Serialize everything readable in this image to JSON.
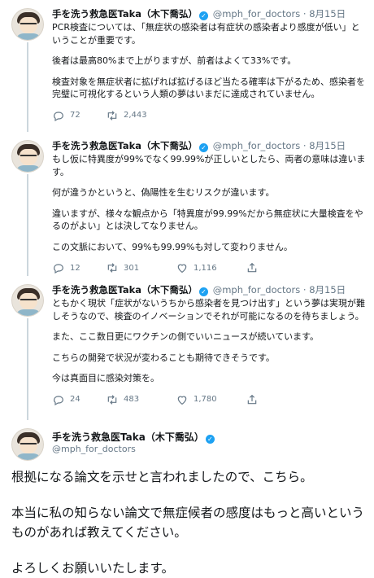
{
  "thread": [
    {
      "display_name": "手を洗う救急医Taka（木下喬弘）",
      "handle": "@mph_for_doctors",
      "dot": "·",
      "date": "8月15日",
      "paragraphs": [
        "PCR検査については、「無症状の感染者は有症状の感染者より感度が低い」ということが重要です。",
        "後者は最高80%まで上がりますが、前者はよくて33%です。",
        "検査対象を無症状者に拡げれば拡げるほど当たる確率は下がるため、感染者を完璧に可視化するという人類の夢はいまだに達成されていません。"
      ],
      "replies": "72",
      "retweets": "2,443",
      "likes": "",
      "like_hidden": true
    },
    {
      "display_name": "手を洗う救急医Taka（木下喬弘）",
      "handle": "@mph_for_doctors",
      "dot": "·",
      "date": "8月15日",
      "paragraphs": [
        "もし仮に特異度が99%でなく99.99%が正しいとしたら、両者の意味は違います。",
        "何が違うかというと、偽陽性を生むリスクが違います。",
        "違いますが、様々な観点から「特異度が99.99%だから無症状に大量検査をやるのがよい」とは決してなりません。",
        "この文脈において、99%も99.99%も対して変わりません。"
      ],
      "replies": "12",
      "retweets": "301",
      "likes": "1,116",
      "like_hidden": false
    },
    {
      "display_name": "手を洗う救急医Taka（木下喬弘）",
      "handle": "@mph_for_doctors",
      "dot": "·",
      "date": "8月15日",
      "paragraphs": [
        "ともかく現状「症状がないうちから感染者を見つけ出す」という夢は実現が難しそうなので、検査のイノベーションでそれが可能になるのを待ちましょう。",
        "また、ここ数日更にワクチンの側でいいニュースが続いています。",
        "こちらの開発で状況が変わることも期待できそうです。",
        "今は真面目に感染対策を。"
      ],
      "replies": "24",
      "retweets": "483",
      "likes": "1,780",
      "like_hidden": false
    }
  ],
  "main_tweet": {
    "display_name": "手を洗う救急医Taka（木下喬弘）",
    "handle": "@mph_for_doctors",
    "paragraphs": [
      "根拠になる論文を示せと言われましたので、こちら。",
      "本当に私の知らない論文で無症候者の感度はもっと高いというものがあれば教えてください。",
      "よろしくお願いいたします。"
    ]
  },
  "icons": {
    "reply": "reply-icon",
    "retweet": "retweet-icon",
    "like": "heart-icon",
    "share": "share-icon",
    "verified": "verified-badge-icon"
  },
  "colors": {
    "accent": "#1da1f2",
    "secondary_text": "#657786",
    "thread_line": "#ccd6dd"
  }
}
